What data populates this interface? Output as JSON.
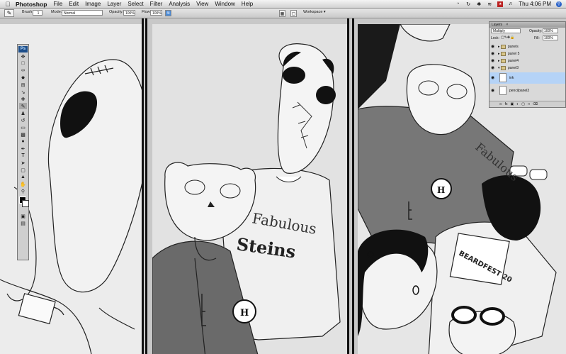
{
  "menubar": {
    "apple_icon": "apple-icon",
    "app_name": "Photoshop",
    "items": [
      "File",
      "Edit",
      "Image",
      "Layer",
      "Select",
      "Filter",
      "Analysis",
      "View",
      "Window",
      "Help"
    ],
    "clock": "Thu 4:06 PM",
    "status_icons": [
      "time-machine-icon",
      "sync-icon",
      "bluetooth-icon",
      "wifi-icon",
      "flag-icon",
      "volume-icon",
      "spotlight-icon"
    ]
  },
  "options": {
    "brush_label": "Brush:",
    "brush_size": "1",
    "mode_label": "Mode:",
    "mode_value": "Normal",
    "opacity_label": "Opacity:",
    "opacity_value": "100%",
    "flow_label": "Flow:",
    "flow_value": "100%",
    "workspace_label": "Workspace ▾"
  },
  "toolbox": {
    "badge": "Ps",
    "tools": [
      "move-icon",
      "marquee-icon",
      "lasso-icon",
      "magic-wand-icon",
      "crop-icon",
      "eyedropper-icon",
      "healing-icon",
      "brush-icon",
      "stamp-icon",
      "history-brush-icon",
      "eraser-icon",
      "gradient-icon",
      "dodge-icon",
      "pen-icon",
      "type-icon",
      "path-select-icon",
      "shape-icon",
      "3d-icon",
      "hand-icon",
      "zoom-icon"
    ]
  },
  "layers": {
    "title": "Layers",
    "blend": "Multiply",
    "opacity_label": "Opacity:",
    "opacity_value": "100%",
    "lock_label": "Lock:",
    "fill_label": "Fill:",
    "fill_value": "100%",
    "rows": [
      {
        "name": "panels",
        "kind": "group"
      },
      {
        "name": "panel 5",
        "kind": "group"
      },
      {
        "name": "panel4",
        "kind": "group"
      },
      {
        "name": "panel3",
        "kind": "group"
      },
      {
        "name": "ink",
        "kind": "layer"
      },
      {
        "name": "pencilpanel3",
        "kind": "layer"
      }
    ]
  },
  "colors": {
    "accent": "#3a7bd5",
    "selected_row": "#b5d3f7"
  },
  "artwork": {
    "badge_text": "H",
    "shirt_text_1": "Fabulous",
    "shirt_text_2": "Steins",
    "shirt_text_3": "Fabulous",
    "sign_text": "BEARDFEST 20"
  }
}
